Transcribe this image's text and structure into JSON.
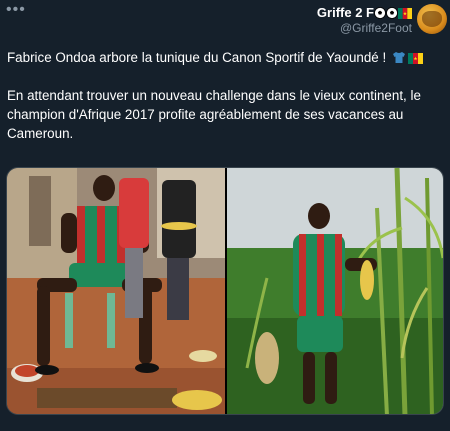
{
  "account": {
    "display_name": "Griffe 2 F",
    "handle": "@Griffe2Foot"
  },
  "tweet": {
    "line1": "Fabrice Ondoa arbore la tunique du Canon Sportif de Yaoundé !",
    "line2": "En attendant trouver un nouveau challenge dans le vieux continent, le champion d'Afrique 2017 profite agréablement de ses vacances au Cameroun."
  },
  "photos": [
    {
      "description_icon": "photo-left-icon"
    },
    {
      "description_icon": "photo-right-icon"
    }
  ],
  "icons": {
    "more": "more-icon",
    "soccer_ball": "soccer-ball-icon",
    "flag_cameroon": "cameroon-flag-icon",
    "shirt": "shirt-icon"
  },
  "colors": {
    "background": "#15202b",
    "secondary_text": "#8b98a5",
    "border": "#38444d",
    "cameroon_green": "#007a5e",
    "cameroon_red": "#ce1126",
    "cameroon_yellow": "#fcd116"
  }
}
